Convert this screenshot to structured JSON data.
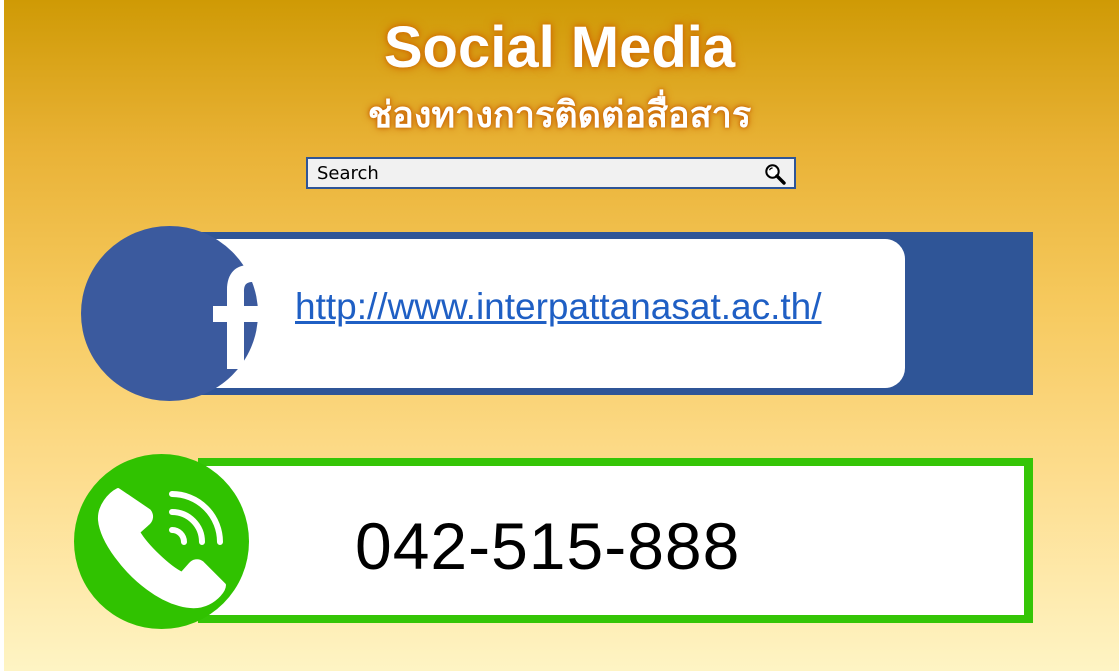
{
  "header": {
    "title": "Social Media",
    "subtitle": "ช่องทางการติดต่อสื่อสาร"
  },
  "search": {
    "placeholder": "Search",
    "icon": "magnifier-icon"
  },
  "facebook": {
    "icon": "facebook-icon",
    "url": "http://www.interpattanasat.ac.th/",
    "brand_color": "#2f5597"
  },
  "phone": {
    "icon": "phone-call-icon",
    "number": "042-515-888",
    "brand_color": "#35c506"
  },
  "colors": {
    "background_top": "#cf9a05",
    "background_bottom": "#fef4c4"
  }
}
